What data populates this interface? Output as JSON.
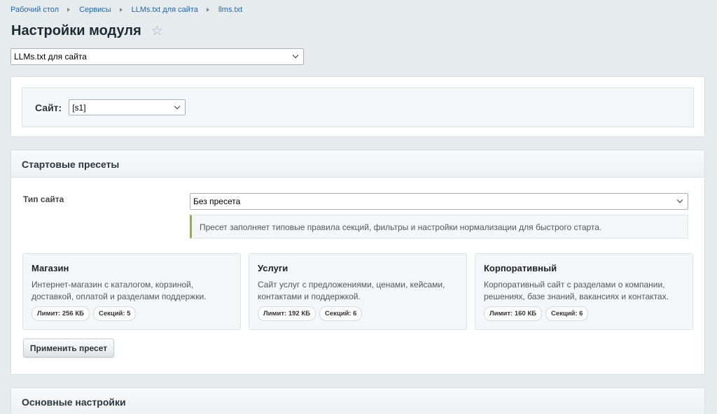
{
  "breadcrumbs": [
    "Рабочий стол",
    "Сервисы",
    "LLMs.txt для сайта",
    "llms.txt"
  ],
  "page": {
    "title": "Настройки модуля"
  },
  "module_select": {
    "value": "LLMs.txt для сайта"
  },
  "site": {
    "label": "Сайт:",
    "value": "[s1]"
  },
  "presets": {
    "header": "Стартовые пресеты",
    "type_label": "Тип сайта",
    "type_value": "Без пресета",
    "hint": "Пресет заполняет типовые правила секций, фильтры и настройки нормализации для быстрого старта.",
    "cards": [
      {
        "title": "Магазин",
        "description": "Интернет-магазин с каталогом, корзиной, доставкой, оплатой и разделами поддержки.",
        "limit": "Лимит: 256 КБ",
        "sections": "Секций: 5"
      },
      {
        "title": "Услуги",
        "description": "Сайт услуг с предложениями, ценами, кейсами, контактами и поддержкой.",
        "limit": "Лимит: 192 КБ",
        "sections": "Секций: 6"
      },
      {
        "title": "Корпоративный",
        "description": "Корпоративный сайт с разделами о компании, решениях, базе знаний, вакансиях и контактах.",
        "limit": "Лимит: 160 КБ",
        "sections": "Секций: 6"
      }
    ],
    "apply_label": "Применить пресет"
  },
  "main_settings": {
    "header": "Основные настройки"
  },
  "colors": {
    "link": "#2067b0",
    "background": "#e6ebee",
    "hint_accent": "#8cb534"
  },
  "icons": {
    "favorite": "star-icon",
    "dropdown": "chevron-down-icon",
    "breadcrumb_separator": "triangle-right-icon"
  }
}
